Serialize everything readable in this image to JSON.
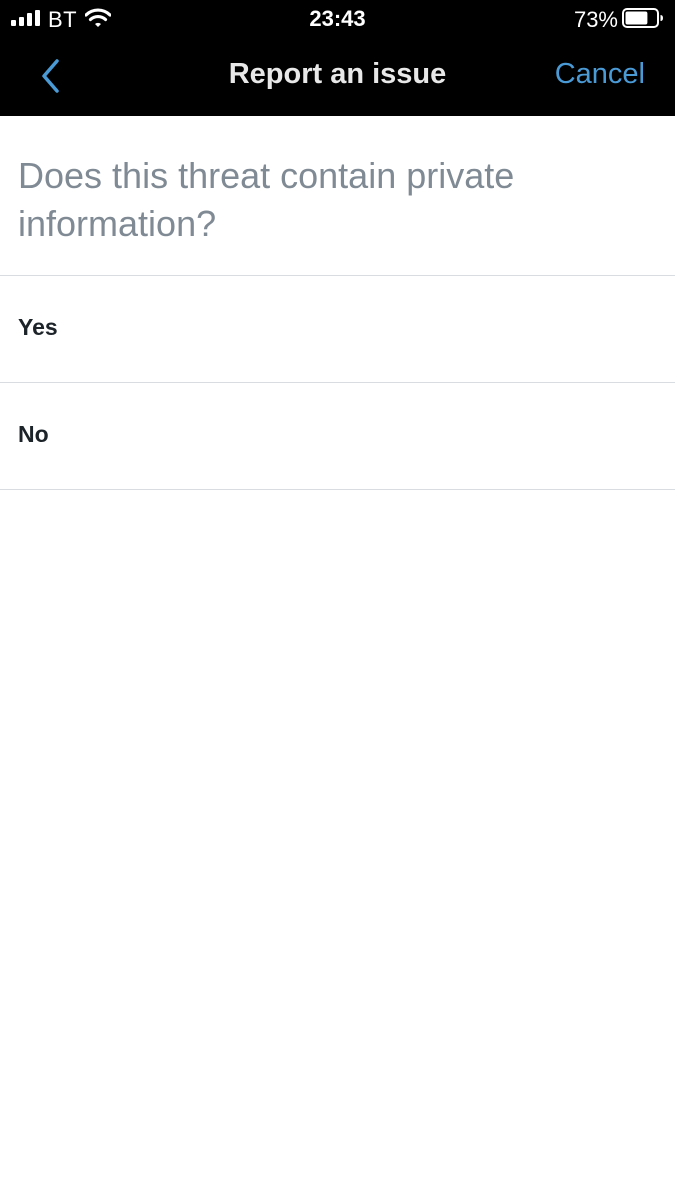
{
  "status_bar": {
    "carrier": "BT",
    "time": "23:43",
    "battery_percent": "73%",
    "battery_level": 0.73,
    "signal_bars": 4
  },
  "nav": {
    "title": "Report an issue",
    "cancel_label": "Cancel",
    "back_icon": "chevron-left-icon"
  },
  "question": "Does this threat contain private information?",
  "options": [
    {
      "label": "Yes"
    },
    {
      "label": "No"
    }
  ],
  "colors": {
    "accent": "#4a9ad6",
    "nav_background": "#000000",
    "question_text": "#7f8a94",
    "divider": "#d9dde1"
  }
}
